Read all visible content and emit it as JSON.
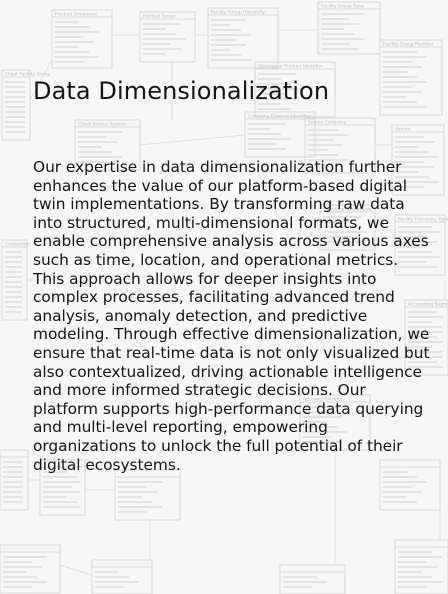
{
  "article": {
    "title": "Data Dimensionalization",
    "body": "Our expertise in data dimensionalization further enhances the value of our platform-based digital twin implementations. By transforming raw data into structured, multi-dimensional formats, we enable comprehensive analysis across various axes such as time, location, and operational metrics. This approach allows for deeper insights into complex processes, facilitating advanced trend analysis, anomaly detection, and predictive modeling. Through effective dimensionalization, we ensure that real-time data is not only visualized but also contextualized, driving actionable intelligence and more informed strategic decisions. Our platform supports high-performance data querying and multi-level reporting, empowering organizations to unlock the full potential of their digital ecosystems."
  },
  "background": {
    "table_headers": [
      "Product Dimension",
      "Product Group",
      "Facility Group Hierarchy",
      "Facility Group Type",
      "Facility Group Member",
      "Client Facility Group",
      "Alternative Product Identifier",
      "Client Source System",
      "Company External Identifier",
      "Source Company",
      "Vendor",
      "Competitor",
      "Company Group Type",
      "Facility Hierarchy Type",
      "Accounting Segment",
      "Accounts Product"
    ]
  }
}
